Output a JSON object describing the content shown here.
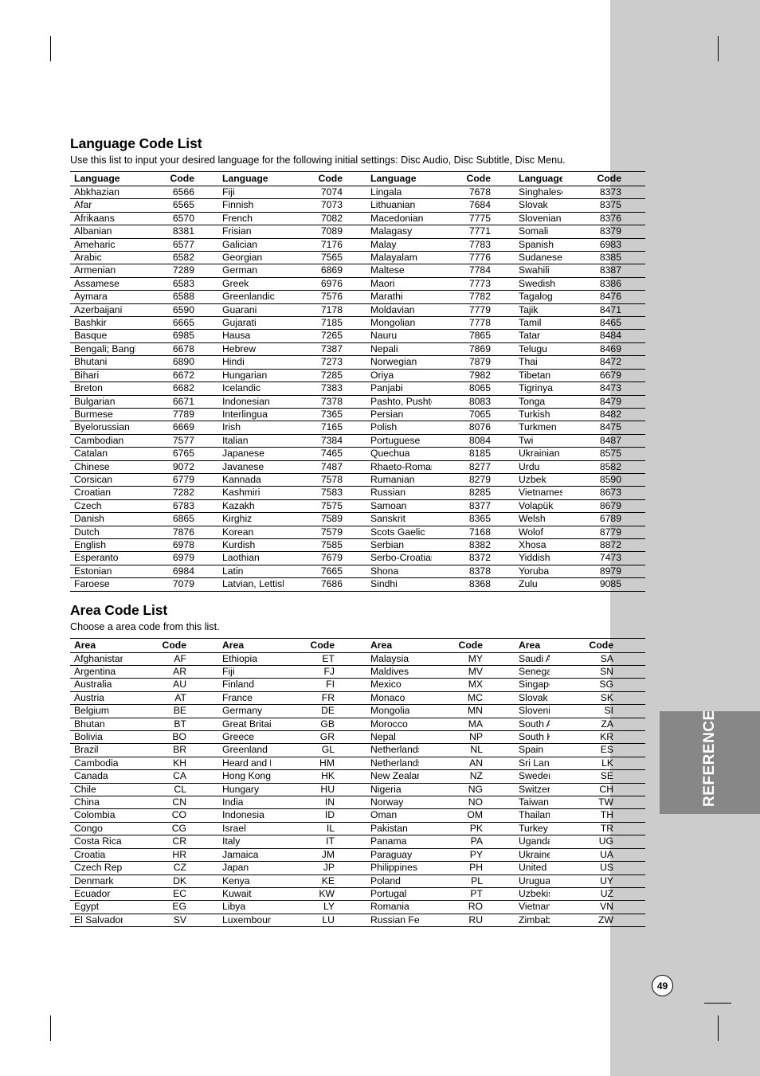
{
  "page": {
    "number": "49",
    "side_tab_label": "REFERENCE"
  },
  "language_section": {
    "title": "Language Code List",
    "subtitle": "Use this list to input your desired language for the following initial settings: Disc Audio, Disc Subtitle, Disc Menu.",
    "headers": {
      "name": "Language",
      "code": "Code"
    },
    "columns": [
      [
        {
          "name": "Abkhazian",
          "code": "6566"
        },
        {
          "name": "Afar",
          "code": "6565"
        },
        {
          "name": "Afrikaans",
          "code": "6570"
        },
        {
          "name": "Albanian",
          "code": "8381"
        },
        {
          "name": "Ameharic",
          "code": "6577"
        },
        {
          "name": "Arabic",
          "code": "6582"
        },
        {
          "name": "Armenian",
          "code": "7289"
        },
        {
          "name": "Assamese",
          "code": "6583"
        },
        {
          "name": "Aymara",
          "code": "6588"
        },
        {
          "name": "Azerbaijani",
          "code": "6590"
        },
        {
          "name": "Bashkir",
          "code": "6665"
        },
        {
          "name": "Basque",
          "code": "6985"
        },
        {
          "name": "Bengali; Bangla",
          "code": "6678"
        },
        {
          "name": "Bhutani",
          "code": "6890"
        },
        {
          "name": "Bihari",
          "code": "6672"
        },
        {
          "name": "Breton",
          "code": "6682"
        },
        {
          "name": "Bulgarian",
          "code": "6671"
        },
        {
          "name": "Burmese",
          "code": "7789"
        },
        {
          "name": "Byelorussian",
          "code": "6669"
        },
        {
          "name": "Cambodian",
          "code": "7577"
        },
        {
          "name": "Catalan",
          "code": "6765"
        },
        {
          "name": "Chinese",
          "code": "9072"
        },
        {
          "name": "Corsican",
          "code": "6779"
        },
        {
          "name": "Croatian",
          "code": "7282"
        },
        {
          "name": "Czech",
          "code": "6783"
        },
        {
          "name": "Danish",
          "code": "6865"
        },
        {
          "name": "Dutch",
          "code": "7876"
        },
        {
          "name": "English",
          "code": "6978"
        },
        {
          "name": "Esperanto",
          "code": "6979"
        },
        {
          "name": "Estonian",
          "code": "6984"
        },
        {
          "name": "Faroese",
          "code": "7079"
        }
      ],
      [
        {
          "name": "Fiji",
          "code": "7074"
        },
        {
          "name": "Finnish",
          "code": "7073"
        },
        {
          "name": "French",
          "code": "7082"
        },
        {
          "name": "Frisian",
          "code": "7089"
        },
        {
          "name": "Galician",
          "code": "7176"
        },
        {
          "name": "Georgian",
          "code": "7565"
        },
        {
          "name": "German",
          "code": "6869"
        },
        {
          "name": "Greek",
          "code": "6976"
        },
        {
          "name": "Greenlandic",
          "code": "7576"
        },
        {
          "name": "Guarani",
          "code": "7178"
        },
        {
          "name": "Gujarati",
          "code": "7185"
        },
        {
          "name": "Hausa",
          "code": "7265"
        },
        {
          "name": "Hebrew",
          "code": "7387"
        },
        {
          "name": "Hindi",
          "code": "7273"
        },
        {
          "name": "Hungarian",
          "code": "7285"
        },
        {
          "name": "Icelandic",
          "code": "7383"
        },
        {
          "name": "Indonesian",
          "code": "7378"
        },
        {
          "name": "Interlingua",
          "code": "7365"
        },
        {
          "name": "Irish",
          "code": "7165"
        },
        {
          "name": "Italian",
          "code": "7384"
        },
        {
          "name": "Japanese",
          "code": "7465"
        },
        {
          "name": "Javanese",
          "code": "7487"
        },
        {
          "name": "Kannada",
          "code": "7578"
        },
        {
          "name": "Kashmiri",
          "code": "7583"
        },
        {
          "name": "Kazakh",
          "code": "7575"
        },
        {
          "name": "Kirghiz",
          "code": "7589"
        },
        {
          "name": "Korean",
          "code": "7579"
        },
        {
          "name": "Kurdish",
          "code": "7585"
        },
        {
          "name": "Laothian",
          "code": "7679"
        },
        {
          "name": "Latin",
          "code": "7665"
        },
        {
          "name": "Latvian, Lettish",
          "code": "7686"
        }
      ],
      [
        {
          "name": "Lingala",
          "code": "7678"
        },
        {
          "name": "Lithuanian",
          "code": "7684"
        },
        {
          "name": "Macedonian",
          "code": "7775"
        },
        {
          "name": "Malagasy",
          "code": "7771"
        },
        {
          "name": "Malay",
          "code": "7783"
        },
        {
          "name": "Malayalam",
          "code": "7776"
        },
        {
          "name": "Maltese",
          "code": "7784"
        },
        {
          "name": "Maori",
          "code": "7773"
        },
        {
          "name": "Marathi",
          "code": "7782"
        },
        {
          "name": "Moldavian",
          "code": "7779"
        },
        {
          "name": "Mongolian",
          "code": "7778"
        },
        {
          "name": "Nauru",
          "code": "7865"
        },
        {
          "name": "Nepali",
          "code": "7869"
        },
        {
          "name": "Norwegian",
          "code": "7879"
        },
        {
          "name": "Oriya",
          "code": "7982"
        },
        {
          "name": "Panjabi",
          "code": "8065"
        },
        {
          "name": "Pashto, Pushto",
          "code": "8083"
        },
        {
          "name": "Persian",
          "code": "7065"
        },
        {
          "name": "Polish",
          "code": "8076"
        },
        {
          "name": "Portuguese",
          "code": "8084"
        },
        {
          "name": "Quechua",
          "code": "8185"
        },
        {
          "name": "Rhaeto-Romance",
          "code": "8277"
        },
        {
          "name": "Rumanian",
          "code": "8279"
        },
        {
          "name": "Russian",
          "code": "8285"
        },
        {
          "name": "Samoan",
          "code": "8377"
        },
        {
          "name": "Sanskrit",
          "code": "8365"
        },
        {
          "name": "Scots Gaelic",
          "code": "7168"
        },
        {
          "name": "Serbian",
          "code": "8382"
        },
        {
          "name": "Serbo-Croatian",
          "code": "8372"
        },
        {
          "name": "Shona",
          "code": "8378"
        },
        {
          "name": "Sindhi",
          "code": "8368"
        }
      ],
      [
        {
          "name": "Singhalese",
          "code": "8373"
        },
        {
          "name": "Slovak",
          "code": "8375"
        },
        {
          "name": "Slovenian",
          "code": "8376"
        },
        {
          "name": "Somali",
          "code": "8379"
        },
        {
          "name": "Spanish",
          "code": "6983"
        },
        {
          "name": "Sudanese",
          "code": "8385"
        },
        {
          "name": "Swahili",
          "code": "8387"
        },
        {
          "name": "Swedish",
          "code": "8386"
        },
        {
          "name": "Tagalog",
          "code": "8476"
        },
        {
          "name": "Tajik",
          "code": "8471"
        },
        {
          "name": "Tamil",
          "code": "8465"
        },
        {
          "name": "Tatar",
          "code": "8484"
        },
        {
          "name": "Telugu",
          "code": "8469"
        },
        {
          "name": "Thai",
          "code": "8472"
        },
        {
          "name": "Tibetan",
          "code": "6679"
        },
        {
          "name": "Tigrinya",
          "code": "8473"
        },
        {
          "name": "Tonga",
          "code": "8479"
        },
        {
          "name": "Turkish",
          "code": "8482"
        },
        {
          "name": "Turkmen",
          "code": "8475"
        },
        {
          "name": "Twi",
          "code": "8487"
        },
        {
          "name": "Ukrainian",
          "code": "8575"
        },
        {
          "name": "Urdu",
          "code": "8582"
        },
        {
          "name": "Uzbek",
          "code": "8590"
        },
        {
          "name": "Vietnamese",
          "code": "8673"
        },
        {
          "name": "Volapük",
          "code": "8679"
        },
        {
          "name": "Welsh",
          "code": "6789"
        },
        {
          "name": "Wolof",
          "code": "8779"
        },
        {
          "name": "Xhosa",
          "code": "8872"
        },
        {
          "name": "Yiddish",
          "code": "7473"
        },
        {
          "name": "Yoruba",
          "code": "8979"
        },
        {
          "name": "Zulu",
          "code": "9085"
        }
      ]
    ]
  },
  "area_section": {
    "title": "Area Code List",
    "subtitle": "Choose a area code from this list.",
    "headers": {
      "name": "Area",
      "code": "Code"
    },
    "columns": [
      [
        {
          "name": "Afghanistan",
          "code": "AF"
        },
        {
          "name": "Argentina",
          "code": "AR"
        },
        {
          "name": "Australia",
          "code": "AU"
        },
        {
          "name": "Austria",
          "code": "AT"
        },
        {
          "name": "Belgium",
          "code": "BE"
        },
        {
          "name": "Bhutan",
          "code": "BT"
        },
        {
          "name": "Bolivia",
          "code": "BO"
        },
        {
          "name": "Brazil",
          "code": "BR"
        },
        {
          "name": "Cambodia",
          "code": "KH"
        },
        {
          "name": "Canada",
          "code": "CA"
        },
        {
          "name": "Chile",
          "code": "CL"
        },
        {
          "name": "China",
          "code": "CN"
        },
        {
          "name": "Colombia",
          "code": "CO"
        },
        {
          "name": "Congo",
          "code": "CG"
        },
        {
          "name": "Costa Rica",
          "code": "CR"
        },
        {
          "name": "Croatia",
          "code": "HR"
        },
        {
          "name": "Czech Republic",
          "code": "CZ"
        },
        {
          "name": "Denmark",
          "code": "DK"
        },
        {
          "name": "Ecuador",
          "code": "EC"
        },
        {
          "name": "Egypt",
          "code": "EG"
        },
        {
          "name": "El Salvador",
          "code": "SV"
        }
      ],
      [
        {
          "name": "Ethiopia",
          "code": "ET"
        },
        {
          "name": "Fiji",
          "code": "FJ"
        },
        {
          "name": "Finland",
          "code": "FI"
        },
        {
          "name": "France",
          "code": "FR"
        },
        {
          "name": "Germany",
          "code": "DE"
        },
        {
          "name": "Great Britain",
          "code": "GB"
        },
        {
          "name": "Greece",
          "code": "GR"
        },
        {
          "name": "Greenland",
          "code": "GL"
        },
        {
          "name": "Heard and McDonald Islands",
          "code": "HM",
          "small": true
        },
        {
          "name": "Hong Kong",
          "code": "HK"
        },
        {
          "name": "Hungary",
          "code": "HU"
        },
        {
          "name": "India",
          "code": "IN"
        },
        {
          "name": "Indonesia",
          "code": "ID"
        },
        {
          "name": "Israel",
          "code": "IL"
        },
        {
          "name": "Italy",
          "code": "IT"
        },
        {
          "name": "Jamaica",
          "code": "JM"
        },
        {
          "name": "Japan",
          "code": "JP"
        },
        {
          "name": "Kenya",
          "code": "KE"
        },
        {
          "name": "Kuwait",
          "code": "KW"
        },
        {
          "name": "Libya",
          "code": "LY"
        },
        {
          "name": "Luxembourg",
          "code": "LU"
        }
      ],
      [
        {
          "name": "Malaysia",
          "code": "MY"
        },
        {
          "name": "Maldives",
          "code": "MV"
        },
        {
          "name": "Mexico",
          "code": "MX"
        },
        {
          "name": "Monaco",
          "code": "MC"
        },
        {
          "name": "Mongolia",
          "code": "MN"
        },
        {
          "name": "Morocco",
          "code": "MA"
        },
        {
          "name": "Nepal",
          "code": "NP"
        },
        {
          "name": "Netherlands",
          "code": "NL"
        },
        {
          "name": "Netherlands Antilles",
          "code": "AN"
        },
        {
          "name": "New Zealand",
          "code": "NZ"
        },
        {
          "name": "Nigeria",
          "code": "NG"
        },
        {
          "name": "Norway",
          "code": "NO"
        },
        {
          "name": "Oman",
          "code": "OM"
        },
        {
          "name": "Pakistan",
          "code": "PK"
        },
        {
          "name": "Panama",
          "code": "PA"
        },
        {
          "name": "Paraguay",
          "code": "PY"
        },
        {
          "name": "Philippines",
          "code": "PH"
        },
        {
          "name": "Poland",
          "code": "PL"
        },
        {
          "name": "Portugal",
          "code": "PT"
        },
        {
          "name": "Romania",
          "code": "RO"
        },
        {
          "name": "Russian Federation",
          "code": "RU"
        }
      ],
      [
        {
          "name": "Saudi Arabia",
          "code": "SA"
        },
        {
          "name": "Senegal",
          "code": "SN"
        },
        {
          "name": "Singapore",
          "code": "SG"
        },
        {
          "name": "Slovak Republic",
          "code": "SK"
        },
        {
          "name": "Slovenia",
          "code": "SI"
        },
        {
          "name": "South Africa",
          "code": "ZA"
        },
        {
          "name": "South Korea",
          "code": "KR"
        },
        {
          "name": "Spain",
          "code": "ES"
        },
        {
          "name": "Sri Lanka",
          "code": "LK"
        },
        {
          "name": "Sweden",
          "code": "SE"
        },
        {
          "name": "Switzerland",
          "code": "CH"
        },
        {
          "name": "Taiwan",
          "code": "TW"
        },
        {
          "name": "Thailand",
          "code": "TH"
        },
        {
          "name": "Turkey",
          "code": "TR"
        },
        {
          "name": "Uganda",
          "code": "UG"
        },
        {
          "name": "Ukraine",
          "code": "UA"
        },
        {
          "name": "United States",
          "code": "US"
        },
        {
          "name": "Uruguay",
          "code": "UY"
        },
        {
          "name": "Uzbekistan",
          "code": "UZ"
        },
        {
          "name": "Vietnam",
          "code": "VN"
        },
        {
          "name": "Zimbabwe",
          "code": "ZW"
        }
      ]
    ]
  }
}
